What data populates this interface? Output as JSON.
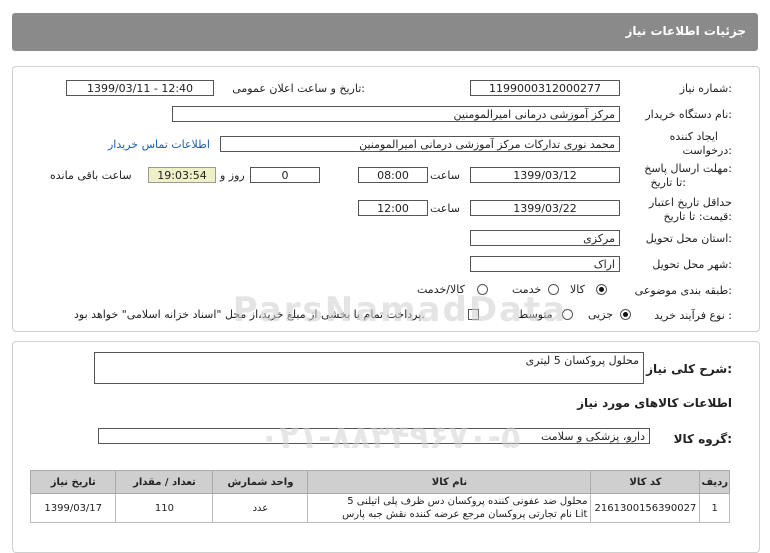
{
  "header": {
    "title": "جزئیات اطلاعات نیاز"
  },
  "fields": {
    "need_number_label": "شماره نیاز:",
    "need_number": "1199000312000277",
    "announce_label": "تاریخ و ساعت اعلان عمومی:",
    "announce_value": "1399/03/11 - 12:40",
    "buyer_label": "نام دستگاه خریدار:",
    "buyer_value": "مرکز آموزشی  درمانی امیرالمومنین",
    "creator_label_1": "ایجاد کننده",
    "creator_label_2": "درخواست:",
    "creator_value": "محمد نوری تدارکات مرکز آموزشی درمانی امیرالمومنین",
    "contact_link": "اطلاعات تماس خریدار",
    "send_deadline_label_1": "مهلت ارسال پاسخ:",
    "send_deadline_label_2": "تا تاریخ:",
    "send_date": "1399/03/12",
    "time_label": "ساعت",
    "send_time": "08:00",
    "days_value": "0",
    "days_label": "روز و",
    "remaining_time": "19:03:54",
    "remaining_label": "ساعت باقی مانده",
    "validity_label_1": "حداقل تاریخ اعتبار",
    "validity_label_2": "قیمت: تا تاریخ:",
    "validity_date": "1399/03/22",
    "validity_time": "12:00",
    "province_label": "استان محل تحویل:",
    "province_value": "مرکزی",
    "city_label": "شهر محل تحویل:",
    "city_value": "اراک",
    "category_label": "طبقه بندی موضوعی:",
    "category_options": [
      "کالا",
      "خدمت",
      "کالا/خدمت"
    ],
    "category_selected": "کالا",
    "purchase_label": "نوع فرآیند خرید :",
    "purchase_options": [
      "جزیی",
      "متوسط"
    ],
    "purchase_selected": "جزیی",
    "payment_note": "پرداخت تمام یا بخشی از مبلغ خرید،از محل \"اسناد خزانه اسلامی\" خواهد بود."
  },
  "details": {
    "summary_label": "شرح کلی نیاز:",
    "summary_value": "محلول پروکسان 5 لیتری",
    "goods_info_title": "اطلاعات کالاهای مورد نیاز",
    "goods_group_label": "گروه کالا:",
    "goods_group_value": "دارو، پزشکی و سلامت"
  },
  "table": {
    "headers": [
      "ردیف",
      "کد کالا",
      "نام کالا",
      "واحد شمارش",
      "تعداد / مقدار",
      "تاریخ نیاز"
    ],
    "rows": [
      {
        "index": "1",
        "code": "2161300156390027",
        "name_line1": "محلول ضد عفونی کننده پروکسان دس ظرف پلی اتیلنی 5",
        "name_line2": "Lit نام تجارتی پروکسان مرجع عرضه کننده نقش جبه پارس",
        "unit": "عدد",
        "qty": "110",
        "date": "1399/03/17"
      }
    ]
  },
  "watermark": {
    "brand": "ParsNamadData",
    "phone": "۰۲۱-۸۸۳۴۹۶۷۰-۵"
  }
}
